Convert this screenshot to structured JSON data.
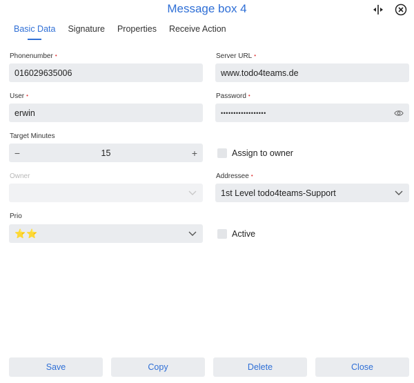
{
  "window": {
    "title": "Message box 4"
  },
  "tabs": [
    "Basic Data",
    "Signature",
    "Properties",
    "Receive Action"
  ],
  "fields": {
    "phonenumber": {
      "label": "Phonenumber",
      "value": "016029635006"
    },
    "server_url": {
      "label": "Server URL",
      "value": "www.todo4teams.de"
    },
    "user": {
      "label": "User",
      "value": "erwin"
    },
    "password": {
      "label": "Password",
      "value": "••••••••••••••••••"
    },
    "target_minutes": {
      "label": "Target Minutes",
      "value": "15",
      "minus": "−",
      "plus": "+"
    },
    "assign_to_owner": {
      "label": "Assign to owner"
    },
    "owner": {
      "label": "Owner",
      "value": ""
    },
    "addressee": {
      "label": "Addressee",
      "value": "1st Level todo4teams-Support"
    },
    "prio": {
      "label": "Prio",
      "value": "⭐⭐"
    },
    "active": {
      "label": "Active"
    }
  },
  "required_marker": "•",
  "buttons": {
    "save": "Save",
    "copy": "Copy",
    "delete": "Delete",
    "close": "Close"
  },
  "colors": {
    "accent": "#2f6fd6",
    "required": "#e03a3a",
    "field_bg": "#eaecef"
  }
}
